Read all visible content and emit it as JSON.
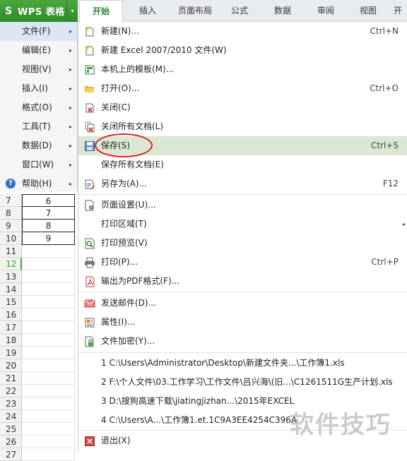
{
  "app": {
    "logo": "S",
    "title": "WPS 表格",
    "drop": "▾"
  },
  "tabs": [
    {
      "label": "开始"
    },
    {
      "label": "插入"
    },
    {
      "label": "页面布局"
    },
    {
      "label": "公式"
    },
    {
      "label": "数据"
    },
    {
      "label": "审阅"
    },
    {
      "label": "视图"
    },
    {
      "label": "开"
    }
  ],
  "left_menu": [
    {
      "label": "文件(F)",
      "arrow": "▸"
    },
    {
      "label": "编辑(E)",
      "arrow": "▸"
    },
    {
      "label": "视图(V)",
      "arrow": "▸"
    },
    {
      "label": "插入(I)",
      "arrow": "▸"
    },
    {
      "label": "格式(O)",
      "arrow": "▸"
    },
    {
      "label": "工具(T)",
      "arrow": "▸"
    },
    {
      "label": "数据(D)",
      "arrow": "▸"
    },
    {
      "label": "窗口(W)",
      "arrow": "▸"
    },
    {
      "label": "帮助(H)",
      "arrow": "▸",
      "icon": "?"
    }
  ],
  "sheet_rows": [
    {
      "num": "7",
      "value": "6"
    },
    {
      "num": "8",
      "value": "7"
    },
    {
      "num": "9",
      "value": "8"
    },
    {
      "num": "10",
      "value": "9"
    },
    {
      "num": "11",
      "value": ""
    },
    {
      "num": "12",
      "value": ""
    },
    {
      "num": "13",
      "value": ""
    },
    {
      "num": "14",
      "value": ""
    },
    {
      "num": "15",
      "value": ""
    },
    {
      "num": "16",
      "value": ""
    },
    {
      "num": "17",
      "value": ""
    },
    {
      "num": "18",
      "value": ""
    },
    {
      "num": "19",
      "value": ""
    },
    {
      "num": "20",
      "value": ""
    },
    {
      "num": "21",
      "value": ""
    },
    {
      "num": "22",
      "value": ""
    },
    {
      "num": "23",
      "value": ""
    },
    {
      "num": "24",
      "value": ""
    },
    {
      "num": "25",
      "value": ""
    },
    {
      "num": "26",
      "value": ""
    },
    {
      "num": "27",
      "value": ""
    }
  ],
  "file_menu": {
    "new": {
      "label": "新建(N)...",
      "shortcut": "Ctrl+N"
    },
    "new_excel": {
      "label": "新建 Excel 2007/2010 文件(W)"
    },
    "local_templates": {
      "label": "本机上的模板(M)..."
    },
    "open": {
      "label": "打开(O)...",
      "shortcut": "Ctrl+O"
    },
    "close": {
      "label": "关闭(C)"
    },
    "close_all": {
      "label": "关闭所有文档(L)"
    },
    "save": {
      "label": "保存(S)",
      "shortcut": "Ctrl+S"
    },
    "save_all": {
      "label": "保存所有文档(E)"
    },
    "save_as": {
      "label": "另存为(A)...",
      "shortcut": "F12"
    },
    "page_setup": {
      "label": "页面设置(U)..."
    },
    "print_area": {
      "label": "打印区域(T)",
      "arrow": "▸"
    },
    "print_preview": {
      "label": "打印预览(V)"
    },
    "print": {
      "label": "打印(P)...",
      "shortcut": "Ctrl+P"
    },
    "export_pdf": {
      "label": "输出为PDF格式(F)..."
    },
    "send_mail": {
      "label": "发送邮件(D)..."
    },
    "properties": {
      "label": "属性(I)..."
    },
    "encrypt": {
      "label": "文件加密(Y)..."
    },
    "recent": [
      "1 C:\\Users\\Administrator\\Desktop\\新建文件夹...\\工作簿1.xls",
      "2 F:\\个人文件\\03.工作学习\\工作文件\\吕兴海\\(旧...\\C1261511G生产计划.xls",
      "3 D:\\搜狗高速下载\\jiatingjizhan...\\2015年EXCEL",
      "4 C:\\Users\\A...\\工作簿1.et.1C9A3EE4254C396A"
    ],
    "exit": {
      "label": "退出(X)"
    }
  },
  "watermark": "软件技巧",
  "colors": {
    "accent_green": "#2e8b2a",
    "highlight": "#dbe7d3",
    "annotation_ring": "#d62020"
  }
}
